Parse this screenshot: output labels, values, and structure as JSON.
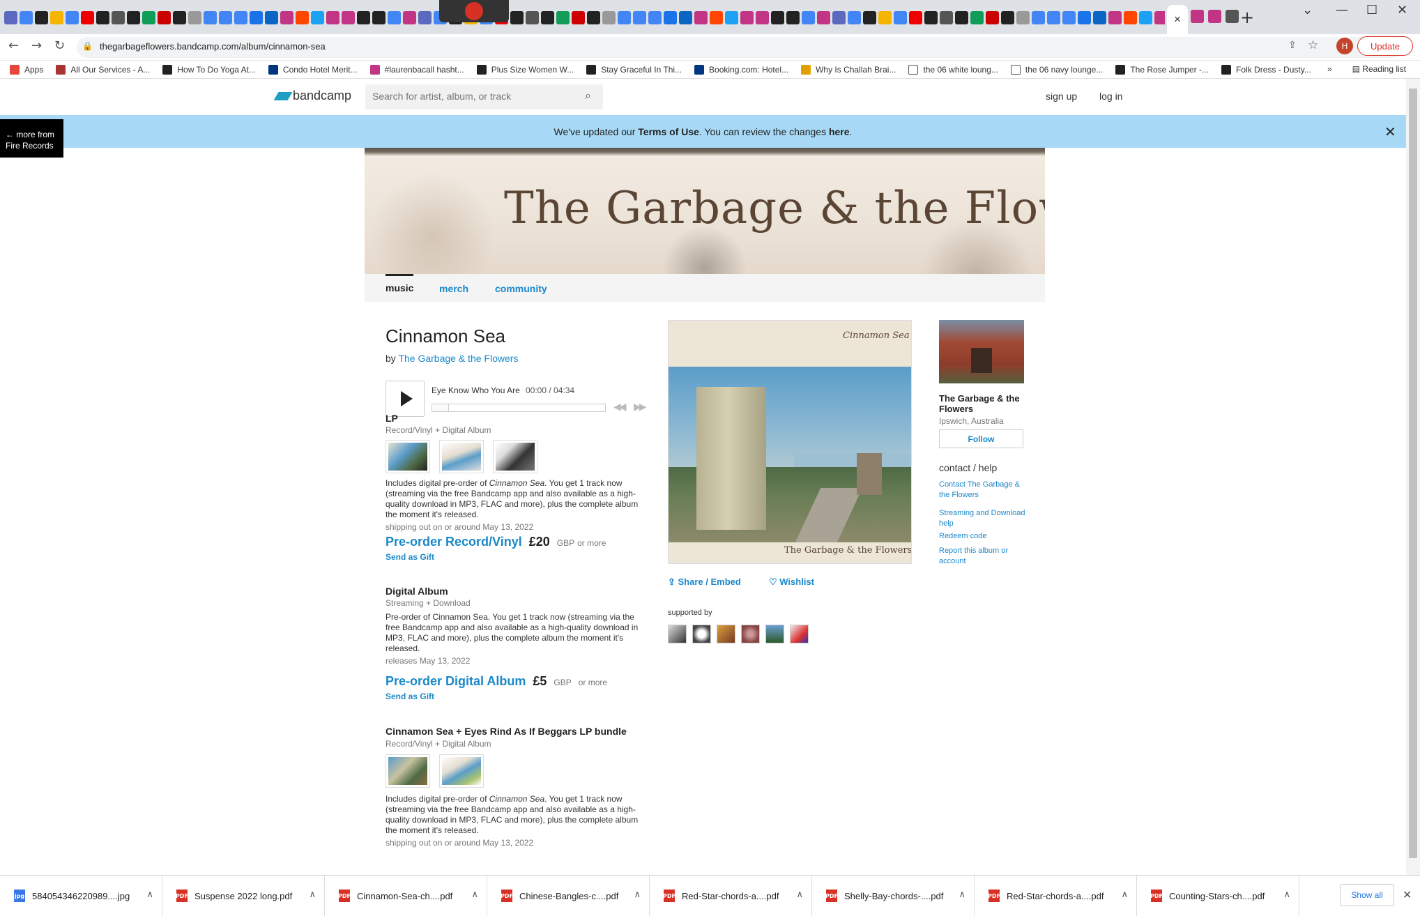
{
  "browser": {
    "active_tab_close": "×",
    "new_tab": "+",
    "url": "thegarbageflowers.bandcamp.com/album/cinnamon-sea",
    "update_label": "Update",
    "avatar_letter": "H",
    "bookmarks": [
      {
        "label": "Apps",
        "icon": "apps-grid",
        "color": "#e8453c"
      },
      {
        "label": "All Our Services - A...",
        "icon": "services",
        "color": "#a33"
      },
      {
        "label": "How To Do Yoga At...",
        "icon": "v-logo",
        "color": "#222"
      },
      {
        "label": "Condo Hotel Merit...",
        "icon": "booking-b",
        "color": "#003580"
      },
      {
        "label": "#laurenbacall hasht...",
        "icon": "instagram",
        "color": "#c13584"
      },
      {
        "label": "Plus Size Women W...",
        "icon": "b-logo",
        "color": "#222"
      },
      {
        "label": "Stay Graceful In Thi...",
        "icon": "b-logo",
        "color": "#222"
      },
      {
        "label": "Booking.com: Hotel...",
        "icon": "booking-b",
        "color": "#003580"
      },
      {
        "label": "Why Is Challah Brai...",
        "icon": "leaf",
        "color": "#e0a000"
      },
      {
        "label": "the 06 white loung...",
        "icon": "square",
        "color": "#fff"
      },
      {
        "label": "the 06 navy lounge...",
        "icon": "square",
        "color": "#fff"
      },
      {
        "label": "The Rose Jumper -...",
        "icon": "check",
        "color": "#222"
      },
      {
        "label": "Folk Dress - Dusty...",
        "icon": "check",
        "color": "#222"
      }
    ],
    "bookmarks_overflow": "»",
    "reading_list": "Reading list"
  },
  "bandcamp": {
    "logo": "bandcamp",
    "search_placeholder": "Search for artist, album, or track",
    "signup": "sign up",
    "login": "log in"
  },
  "notice": {
    "pre": "We've updated our ",
    "terms": "Terms of Use",
    "mid": ". You can review the changes ",
    "here": "here",
    "post": ".",
    "close": "✕"
  },
  "more_from": {
    "line1": "← more from",
    "line2": "Fire Records"
  },
  "banner": {
    "title": "The Garbage & the Flowers"
  },
  "nav": {
    "music": "music",
    "merch": "merch",
    "community": "community"
  },
  "album": {
    "title": "Cinnamon Sea",
    "by_prefix": "by",
    "artist": "The Garbage & the Flowers"
  },
  "player": {
    "track": "Eye Know Who You Are",
    "time": "00:00 / 04:34",
    "progress": 0
  },
  "packages": [
    {
      "title": "LP",
      "subtitle": "Record/Vinyl + Digital Album",
      "desc_pre": "Includes digital pre-order of ",
      "desc_em": "Cinnamon Sea",
      "desc_post": ". You get 1 track now (streaming via the free Bandcamp app and also available as a high-quality download in MP3, FLAC and more), plus the complete album the moment it's released.",
      "ship": "shipping out on or around May 13, 2022",
      "buy": "Pre-order Record/Vinyl",
      "price": "£20",
      "currency": "GBP",
      "or_more": "or more",
      "gift": "Send as Gift"
    },
    {
      "title": "Digital Album",
      "subtitle": "Streaming + Download",
      "desc": "Pre-order of Cinnamon Sea. You get 1 track now (streaming via the free Bandcamp app and also available as a high-quality download in MP3, FLAC and more), plus the complete album the moment it's released.",
      "ship": "releases May 13, 2022",
      "buy": "Pre-order Digital Album",
      "price": "£5",
      "currency": "GBP",
      "or_more": "or more",
      "gift": "Send as Gift"
    },
    {
      "title": "Cinnamon Sea + Eyes Rind As If Beggars LP bundle",
      "subtitle": "Record/Vinyl + Digital Album",
      "desc_pre": "Includes digital pre-order of ",
      "desc_em": "Cinnamon Sea",
      "desc_post": ". You get 1 track now (streaming via the free Bandcamp app and also available as a high-quality download in MP3, FLAC and more), plus the complete album the moment it's released.",
      "ship": "shipping out on or around May 13, 2022"
    }
  ],
  "cover": {
    "top_text": "Cinnamon Sea",
    "bottom_text": "The Garbage & the Flowers"
  },
  "actions": {
    "share": "Share / Embed",
    "wishlist": "Wishlist"
  },
  "supported_by": "supported by",
  "artist_card": {
    "name": "The Garbage & the Flowers",
    "location": "Ipswich, Australia",
    "follow": "Follow",
    "contact_help": "contact / help",
    "links": [
      "Contact The Garbage & the Flowers",
      "Streaming and Download help",
      "Redeem code",
      "Report this album or account"
    ]
  },
  "downloads": {
    "items": [
      {
        "name": "584054346220989....jpg",
        "type": "jpg"
      },
      {
        "name": "Suspense 2022 long.pdf",
        "type": "PDF"
      },
      {
        "name": "Cinnamon-Sea-ch....pdf",
        "type": "PDF"
      },
      {
        "name": "Chinese-Bangles-c....pdf",
        "type": "PDF"
      },
      {
        "name": "Red-Star-chords-a....pdf",
        "type": "PDF"
      },
      {
        "name": "Shelly-Bay-chords-....pdf",
        "type": "PDF"
      },
      {
        "name": "Red-Star-chords-a....pdf",
        "type": "PDF"
      },
      {
        "name": "Counting-Stars-ch....pdf",
        "type": "PDF"
      }
    ],
    "show_all": "Show all",
    "close": "✕"
  },
  "colors": {
    "link": "#1a88c9",
    "notice": "#a7d9f6",
    "update": "#d93025"
  }
}
